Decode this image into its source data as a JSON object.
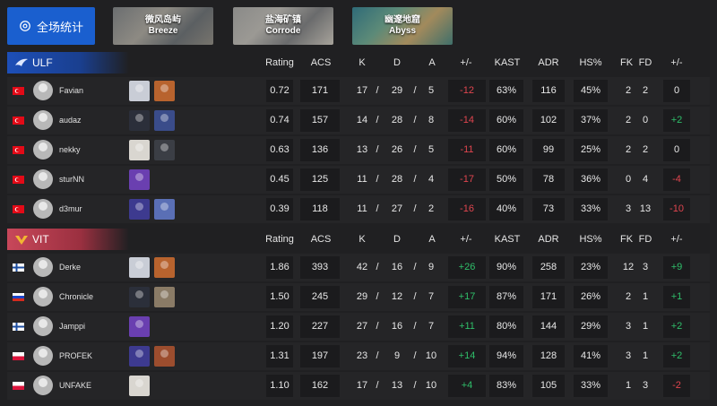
{
  "all_stats_label": "全场统计",
  "maps": [
    {
      "cn": "微风岛屿",
      "en": "Breeze"
    },
    {
      "cn": "盐海矿镇",
      "en": "Corrode"
    },
    {
      "cn": "幽邃地窟",
      "en": "Abyss"
    }
  ],
  "columns": [
    "Rating",
    "ACS",
    "K",
    "D",
    "A",
    "+/-",
    "KAST",
    "ADR",
    "HS%",
    "FK",
    "FD",
    "+/-"
  ],
  "colors": {
    "accent": "#1a5fcf",
    "ulf": "#1d4fb8",
    "vit": "#c8475a",
    "positive": "#2fbf6a",
    "negative": "#e0454f"
  },
  "teams": [
    {
      "name": "ULF",
      "players": [
        {
          "flag": "TR",
          "name": "Favian",
          "agents": [
            "agent-a",
            "agent-b"
          ],
          "rating": "0.72",
          "acs": "171",
          "k": "17",
          "d": "29",
          "a": "5",
          "pm": "-12",
          "kast": "63%",
          "adr": "116",
          "hs": "45%",
          "fk": "2",
          "fd": "2",
          "fpm": "0"
        },
        {
          "flag": "TR",
          "name": "audaz",
          "agents": [
            "agent-c",
            "agent-d"
          ],
          "rating": "0.74",
          "acs": "157",
          "k": "14",
          "d": "28",
          "a": "8",
          "pm": "-14",
          "kast": "60%",
          "adr": "102",
          "hs": "37%",
          "fk": "2",
          "fd": "0",
          "fpm": "+2"
        },
        {
          "flag": "TR",
          "name": "nekky",
          "agents": [
            "agent-e",
            "agent-f"
          ],
          "rating": "0.63",
          "acs": "136",
          "k": "13",
          "d": "26",
          "a": "5",
          "pm": "-11",
          "kast": "60%",
          "adr": "99",
          "hs": "25%",
          "fk": "2",
          "fd": "2",
          "fpm": "0"
        },
        {
          "flag": "TR",
          "name": "sturNN",
          "agents": [
            "agent-g"
          ],
          "rating": "0.45",
          "acs": "125",
          "k": "11",
          "d": "28",
          "a": "4",
          "pm": "-17",
          "kast": "50%",
          "adr": "78",
          "hs": "36%",
          "fk": "0",
          "fd": "4",
          "fpm": "-4"
        },
        {
          "flag": "TR",
          "name": "d3mur",
          "agents": [
            "agent-h",
            "agent-i"
          ],
          "rating": "0.39",
          "acs": "118",
          "k": "11",
          "d": "27",
          "a": "2",
          "pm": "-16",
          "kast": "40%",
          "adr": "73",
          "hs": "33%",
          "fk": "3",
          "fd": "13",
          "fpm": "-10"
        }
      ]
    },
    {
      "name": "VIT",
      "players": [
        {
          "flag": "FI",
          "name": "Derke",
          "agents": [
            "agent-a",
            "agent-b"
          ],
          "rating": "1.86",
          "acs": "393",
          "k": "42",
          "d": "16",
          "a": "9",
          "pm": "+26",
          "kast": "90%",
          "adr": "258",
          "hs": "23%",
          "fk": "12",
          "fd": "3",
          "fpm": "+9"
        },
        {
          "flag": "RU",
          "name": "Chronicle",
          "agents": [
            "agent-c",
            "agent-j"
          ],
          "rating": "1.50",
          "acs": "245",
          "k": "29",
          "d": "12",
          "a": "7",
          "pm": "+17",
          "kast": "87%",
          "adr": "171",
          "hs": "26%",
          "fk": "2",
          "fd": "1",
          "fpm": "+1"
        },
        {
          "flag": "FI",
          "name": "Jamppi",
          "agents": [
            "agent-g"
          ],
          "rating": "1.20",
          "acs": "227",
          "k": "27",
          "d": "16",
          "a": "7",
          "pm": "+11",
          "kast": "80%",
          "adr": "144",
          "hs": "29%",
          "fk": "3",
          "fd": "1",
          "fpm": "+2"
        },
        {
          "flag": "PL",
          "name": "PROFEK",
          "agents": [
            "agent-h",
            "agent-k"
          ],
          "rating": "1.31",
          "acs": "197",
          "k": "23",
          "d": "9",
          "a": "10",
          "pm": "+14",
          "kast": "94%",
          "adr": "128",
          "hs": "41%",
          "fk": "3",
          "fd": "1",
          "fpm": "+2"
        },
        {
          "flag": "PL",
          "name": "UNFAKE",
          "agents": [
            "agent-e"
          ],
          "rating": "1.10",
          "acs": "162",
          "k": "17",
          "d": "13",
          "a": "10",
          "pm": "+4",
          "kast": "83%",
          "adr": "105",
          "hs": "33%",
          "fk": "1",
          "fd": "3",
          "fpm": "-2"
        }
      ]
    }
  ]
}
